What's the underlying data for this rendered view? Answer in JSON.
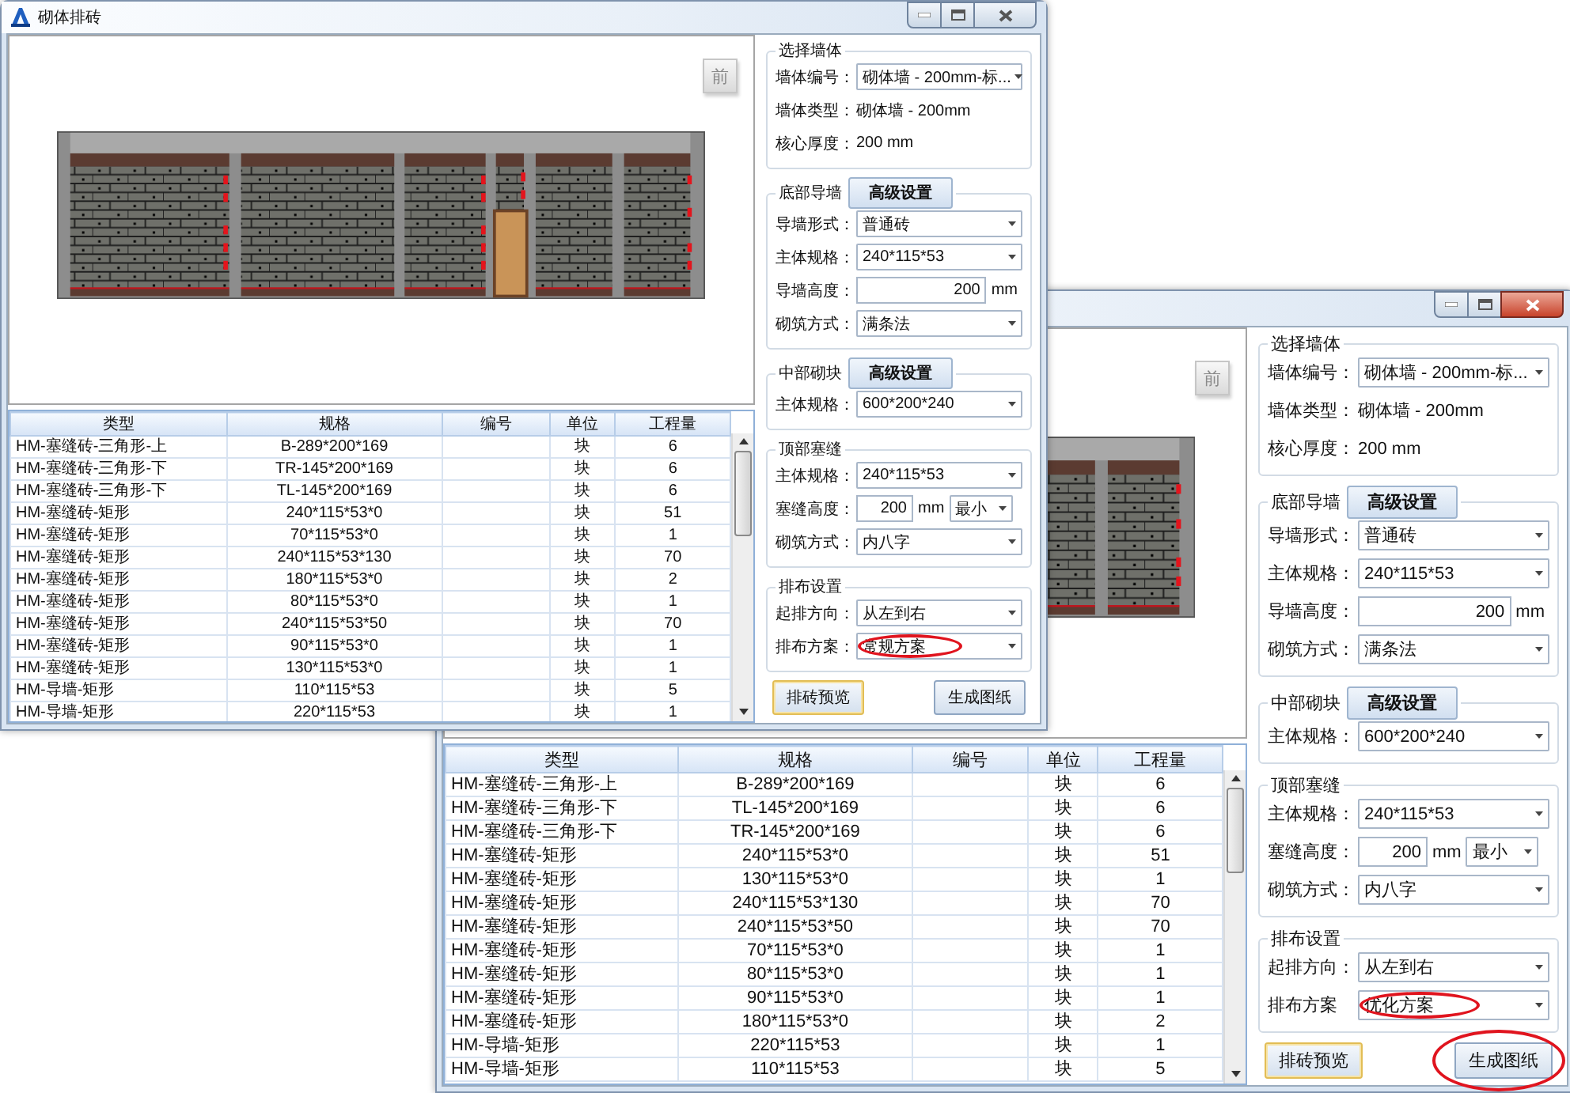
{
  "windows": [
    {
      "title": "砌体排砖",
      "active": false,
      "preview": {
        "view_button": "前"
      },
      "table": {
        "columns": [
          "类型",
          "规格",
          "编号",
          "单位",
          "工程量"
        ],
        "rows": [
          {
            "type": "HM-塞缝砖-三角形-上",
            "spec": "B-289*200*169",
            "unit": "块",
            "quantity": "6"
          },
          {
            "type": "HM-塞缝砖-三角形-下",
            "spec": "TR-145*200*169",
            "unit": "块",
            "quantity": "6"
          },
          {
            "type": "HM-塞缝砖-三角形-下",
            "spec": "TL-145*200*169",
            "unit": "块",
            "quantity": "6"
          },
          {
            "type": "HM-塞缝砖-矩形",
            "spec": "240*115*53*0",
            "unit": "块",
            "quantity": "51"
          },
          {
            "type": "HM-塞缝砖-矩形",
            "spec": "70*115*53*0",
            "unit": "块",
            "quantity": "1"
          },
          {
            "type": "HM-塞缝砖-矩形",
            "spec": "240*115*53*130",
            "unit": "块",
            "quantity": "70"
          },
          {
            "type": "HM-塞缝砖-矩形",
            "spec": "180*115*53*0",
            "unit": "块",
            "quantity": "2"
          },
          {
            "type": "HM-塞缝砖-矩形",
            "spec": "80*115*53*0",
            "unit": "块",
            "quantity": "1"
          },
          {
            "type": "HM-塞缝砖-矩形",
            "spec": "240*115*53*50",
            "unit": "块",
            "quantity": "70"
          },
          {
            "type": "HM-塞缝砖-矩形",
            "spec": "90*115*53*0",
            "unit": "块",
            "quantity": "1"
          },
          {
            "type": "HM-塞缝砖-矩形",
            "spec": "130*115*53*0",
            "unit": "块",
            "quantity": "1"
          },
          {
            "type": "HM-导墙-矩形",
            "spec": "110*115*53",
            "unit": "块",
            "quantity": "5"
          },
          {
            "type": "HM-导墙-矩形",
            "spec": "220*115*53",
            "unit": "块",
            "quantity": "1"
          }
        ]
      },
      "panel": {
        "groups": [
          {
            "title": "选择墙体",
            "rows": [
              {
                "kind": "select",
                "label": "墙体编号：",
                "value": "砌体墙 - 200mm-标..."
              },
              {
                "kind": "info",
                "label": "墙体类型：",
                "value": "砌体墙 - 200mm"
              },
              {
                "kind": "info",
                "label": "核心厚度：",
                "value": "200 mm"
              }
            ]
          },
          {
            "title": "底部导墙",
            "button": "高级设置",
            "rows": [
              {
                "kind": "select",
                "label": "导墙形式：",
                "value": "普通砖"
              },
              {
                "kind": "select",
                "label": "主体规格：",
                "value": "240*115*53"
              },
              {
                "kind": "input",
                "label": "导墙高度：",
                "value": "200",
                "unit": "mm"
              },
              {
                "kind": "select",
                "label": "砌筑方式：",
                "value": "满条法"
              }
            ]
          },
          {
            "title": "中部砌块",
            "button": "高级设置",
            "rows": [
              {
                "kind": "select",
                "label": "主体规格：",
                "value": "600*200*240"
              }
            ]
          },
          {
            "title": "顶部塞缝",
            "rows": [
              {
                "kind": "select",
                "label": "主体规格：",
                "value": "240*115*53"
              },
              {
                "kind": "input_select",
                "label": "塞缝高度：",
                "value": "200",
                "unit": "mm",
                "option": "最小"
              },
              {
                "kind": "select",
                "label": "砌筑方式：",
                "value": "内八字"
              }
            ]
          },
          {
            "title": "排布设置",
            "rows": [
              {
                "kind": "select",
                "label": "起排方向：",
                "value": "从左到右",
                "circled": false
              },
              {
                "kind": "select",
                "label": "排布方案：",
                "value": "常规方案",
                "circled": true
              }
            ]
          }
        ],
        "buttons": [
          {
            "label": "排砖预览",
            "focused": true,
            "circled": false
          },
          {
            "label": "生成图纸",
            "focused": false,
            "circled": false
          }
        ]
      }
    },
    {
      "active": true,
      "preview": {
        "view_button": "前"
      },
      "table": {
        "columns": [
          "类型",
          "规格",
          "编号",
          "单位",
          "工程量"
        ],
        "rows": [
          {
            "type": "HM-塞缝砖-三角形-上",
            "spec": "B-289*200*169",
            "unit": "块",
            "quantity": "6"
          },
          {
            "type": "HM-塞缝砖-三角形-下",
            "spec": "TL-145*200*169",
            "unit": "块",
            "quantity": "6"
          },
          {
            "type": "HM-塞缝砖-三角形-下",
            "spec": "TR-145*200*169",
            "unit": "块",
            "quantity": "6"
          },
          {
            "type": "HM-塞缝砖-矩形",
            "spec": "240*115*53*0",
            "unit": "块",
            "quantity": "51"
          },
          {
            "type": "HM-塞缝砖-矩形",
            "spec": "130*115*53*0",
            "unit": "块",
            "quantity": "1"
          },
          {
            "type": "HM-塞缝砖-矩形",
            "spec": "240*115*53*130",
            "unit": "块",
            "quantity": "70"
          },
          {
            "type": "HM-塞缝砖-矩形",
            "spec": "240*115*53*50",
            "unit": "块",
            "quantity": "70"
          },
          {
            "type": "HM-塞缝砖-矩形",
            "spec": "70*115*53*0",
            "unit": "块",
            "quantity": "1"
          },
          {
            "type": "HM-塞缝砖-矩形",
            "spec": "80*115*53*0",
            "unit": "块",
            "quantity": "1"
          },
          {
            "type": "HM-塞缝砖-矩形",
            "spec": "90*115*53*0",
            "unit": "块",
            "quantity": "1"
          },
          {
            "type": "HM-塞缝砖-矩形",
            "spec": "180*115*53*0",
            "unit": "块",
            "quantity": "2"
          },
          {
            "type": "HM-导墙-矩形",
            "spec": "220*115*53",
            "unit": "块",
            "quantity": "1"
          },
          {
            "type": "HM-导墙-矩形",
            "spec": "110*115*53",
            "unit": "块",
            "quantity": "5"
          }
        ]
      },
      "panel": {
        "groups": [
          {
            "title": "选择墙体",
            "rows": [
              {
                "kind": "select",
                "label": "墙体编号：",
                "value": "砌体墙 - 200mm-标..."
              },
              {
                "kind": "info",
                "label": "墙体类型：",
                "value": "砌体墙 - 200mm"
              },
              {
                "kind": "info",
                "label": "核心厚度：",
                "value": "200 mm"
              }
            ]
          },
          {
            "title": "底部导墙",
            "button": "高级设置",
            "rows": [
              {
                "kind": "select",
                "label": "导墙形式：",
                "value": "普通砖"
              },
              {
                "kind": "select",
                "label": "主体规格：",
                "value": "240*115*53"
              },
              {
                "kind": "input",
                "label": "导墙高度：",
                "value": "200",
                "unit": "mm"
              },
              {
                "kind": "select",
                "label": "砌筑方式：",
                "value": "满条法"
              }
            ]
          },
          {
            "title": "中部砌块",
            "button": "高级设置",
            "rows": [
              {
                "kind": "select",
                "label": "主体规格：",
                "value": "600*200*240"
              }
            ]
          },
          {
            "title": "顶部塞缝",
            "rows": [
              {
                "kind": "select",
                "label": "主体规格：",
                "value": "240*115*53"
              },
              {
                "kind": "input_select",
                "label": "塞缝高度：",
                "value": "200",
                "unit": "mm",
                "option": "最小"
              },
              {
                "kind": "select",
                "label": "砌筑方式：",
                "value": "内八字"
              }
            ]
          },
          {
            "title": "排布设置",
            "rows": [
              {
                "kind": "select",
                "label": "起排方向：",
                "value": "从左到右",
                "circled": false
              },
              {
                "kind": "select",
                "label": "排布方案",
                "value": "优化方案",
                "circled": true
              }
            ]
          }
        ],
        "buttons": [
          {
            "label": "排砖预览",
            "focused": true,
            "circled": false
          },
          {
            "label": "生成图纸",
            "focused": false,
            "circled": true
          }
        ]
      }
    }
  ]
}
